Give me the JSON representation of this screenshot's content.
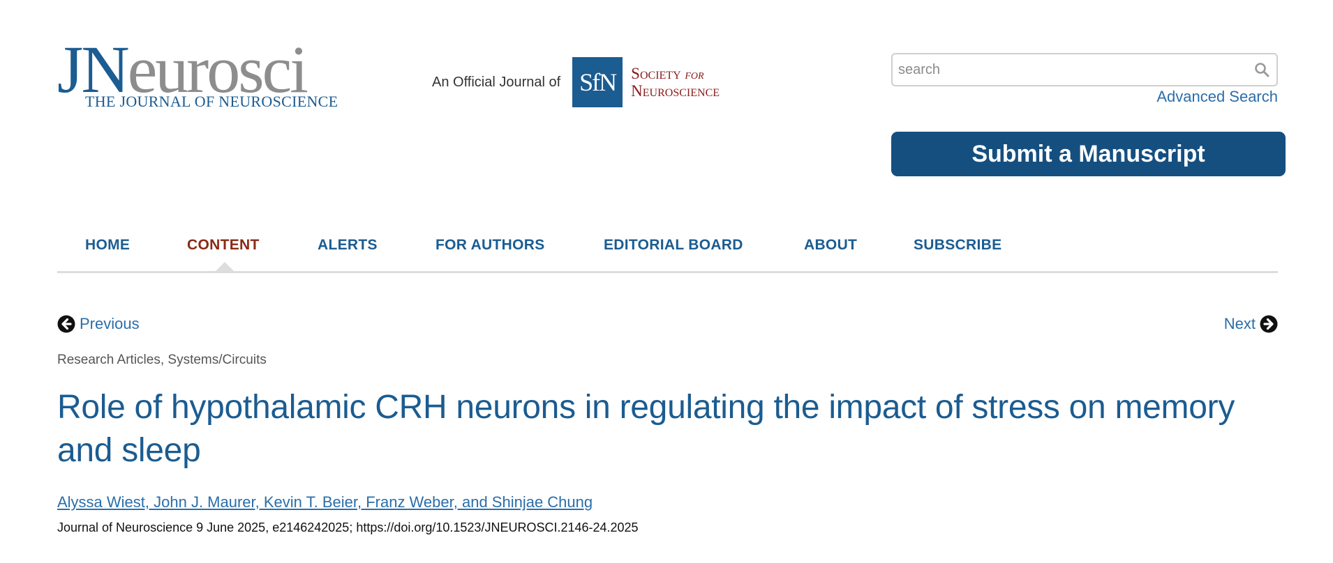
{
  "header": {
    "logo": {
      "j": "J",
      "n": "N",
      "rest": "eurosci",
      "subtitle": "THE JOURNAL OF NEUROSCIENCE"
    },
    "official_label": "An Official Journal of",
    "sfn_logo": {
      "mark": "SfN",
      "line1": "Society",
      "line1_for": "for",
      "line2": "Neuroscience"
    },
    "search": {
      "placeholder": "search",
      "value": "",
      "icon": "search-icon"
    },
    "advanced_search_label": "Advanced Search",
    "submit_label": "Submit a Manuscript"
  },
  "nav": {
    "items": [
      {
        "label": "HOME",
        "active": false
      },
      {
        "label": "CONTENT",
        "active": true
      },
      {
        "label": "ALERTS",
        "active": false
      },
      {
        "label": "FOR AUTHORS",
        "active": false
      },
      {
        "label": "EDITORIAL BOARD",
        "active": false
      },
      {
        "label": "ABOUT",
        "active": false
      },
      {
        "label": "SUBSCRIBE",
        "active": false
      }
    ]
  },
  "pager": {
    "previous_label": "Previous",
    "next_label": "Next"
  },
  "article": {
    "section": "Research Articles, Systems/Circuits",
    "title": "Role of hypothalamic CRH neurons in regulating the impact of stress on memory and sleep",
    "authors": "Alyssa Wiest, John J. Maurer, Kevin T. Beier, Franz Weber, and Shinjae Chung",
    "citation": "Journal of Neuroscience 9 June 2025, e2146242025; https://doi.org/10.1523/JNEUROSCI.2146-24.2025"
  },
  "colors": {
    "brand_blue": "#1b5c91",
    "link_blue": "#2a6eaa",
    "button_blue": "#154f80",
    "active_nav": "#8a2a14",
    "society_red": "#8a1a1a"
  }
}
